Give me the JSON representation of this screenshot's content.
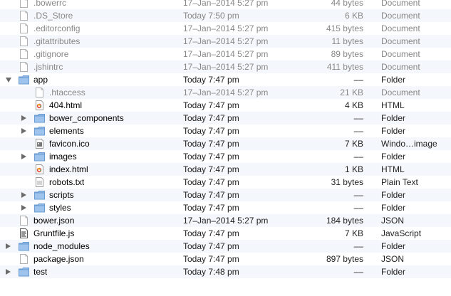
{
  "rows": [
    {
      "name": ".bowerrc",
      "date": "17–Jan–2014 5:27 pm",
      "size": "44 bytes",
      "kind": "Document",
      "depth": 1,
      "icon": "document-icon",
      "dim": true
    },
    {
      "name": ".DS_Store",
      "date": "Today 7:50 pm",
      "size": "6 KB",
      "kind": "Document",
      "depth": 1,
      "icon": "document-icon",
      "dim": true
    },
    {
      "name": ".editorconfig",
      "date": "17–Jan–2014 5:27 pm",
      "size": "415 bytes",
      "kind": "Document",
      "depth": 1,
      "icon": "document-icon",
      "dim": true
    },
    {
      "name": ".gitattributes",
      "date": "17–Jan–2014 5:27 pm",
      "size": "11 bytes",
      "kind": "Document",
      "depth": 1,
      "icon": "document-icon",
      "dim": true
    },
    {
      "name": ".gitignore",
      "date": "17–Jan–2014 5:27 pm",
      "size": "89 bytes",
      "kind": "Document",
      "depth": 1,
      "icon": "document-icon",
      "dim": true
    },
    {
      "name": ".jshintrc",
      "date": "17–Jan–2014 5:27 pm",
      "size": "411 bytes",
      "kind": "Document",
      "depth": 1,
      "icon": "document-icon",
      "dim": true
    },
    {
      "name": "app",
      "date": "Today 7:47 pm",
      "size": "––",
      "kind": "Folder",
      "depth": 1,
      "icon": "folder-icon",
      "toggle": "down"
    },
    {
      "name": ".htaccess",
      "date": "17–Jan–2014 5:27 pm",
      "size": "21 KB",
      "kind": "Document",
      "depth": 2,
      "icon": "document-icon",
      "dim": true
    },
    {
      "name": "404.html",
      "date": "Today 7:47 pm",
      "size": "4 KB",
      "kind": "HTML",
      "depth": 2,
      "icon": "html-file-icon"
    },
    {
      "name": "bower_components",
      "date": "Today 7:47 pm",
      "size": "––",
      "kind": "Folder",
      "depth": 2,
      "icon": "folder-icon",
      "toggle": "right"
    },
    {
      "name": "elements",
      "date": "Today 7:47 pm",
      "size": "––",
      "kind": "Folder",
      "depth": 2,
      "icon": "folder-icon",
      "toggle": "right"
    },
    {
      "name": "favicon.ico",
      "date": "Today 7:47 pm",
      "size": "7 KB",
      "kind": "Windo…image",
      "depth": 2,
      "icon": "image-file-icon"
    },
    {
      "name": "images",
      "date": "Today 7:47 pm",
      "size": "––",
      "kind": "Folder",
      "depth": 2,
      "icon": "folder-icon",
      "toggle": "right"
    },
    {
      "name": "index.html",
      "date": "Today 7:47 pm",
      "size": "1 KB",
      "kind": "HTML",
      "depth": 2,
      "icon": "html-file-icon"
    },
    {
      "name": "robots.txt",
      "date": "Today 7:47 pm",
      "size": "31 bytes",
      "kind": "Plain Text",
      "depth": 2,
      "icon": "text-file-icon"
    },
    {
      "name": "scripts",
      "date": "Today 7:47 pm",
      "size": "––",
      "kind": "Folder",
      "depth": 2,
      "icon": "folder-icon",
      "toggle": "right"
    },
    {
      "name": "styles",
      "date": "Today 7:47 pm",
      "size": "––",
      "kind": "Folder",
      "depth": 2,
      "icon": "folder-icon",
      "toggle": "right"
    },
    {
      "name": "bower.json",
      "date": "17–Jan–2014 5:27 pm",
      "size": "184 bytes",
      "kind": "JSON",
      "depth": 1,
      "icon": "document-icon"
    },
    {
      "name": "Gruntfile.js",
      "date": "Today 7:47 pm",
      "size": "7 KB",
      "kind": "JavaScript",
      "depth": 1,
      "icon": "script-file-icon"
    },
    {
      "name": "node_modules",
      "date": "Today 7:47 pm",
      "size": "––",
      "kind": "Folder",
      "depth": 1,
      "icon": "folder-icon",
      "toggle": "right"
    },
    {
      "name": "package.json",
      "date": "Today 7:47 pm",
      "size": "897 bytes",
      "kind": "JSON",
      "depth": 1,
      "icon": "document-icon"
    },
    {
      "name": "test",
      "date": "Today 7:48 pm",
      "size": "––",
      "kind": "Folder",
      "depth": 1,
      "icon": "folder-icon",
      "toggle": "right"
    }
  ],
  "colors": {
    "folder": "#8fb8e6",
    "folder_dark": "#6a9cd3",
    "zebra": "#f4f7fb",
    "dim_text": "#888888"
  }
}
